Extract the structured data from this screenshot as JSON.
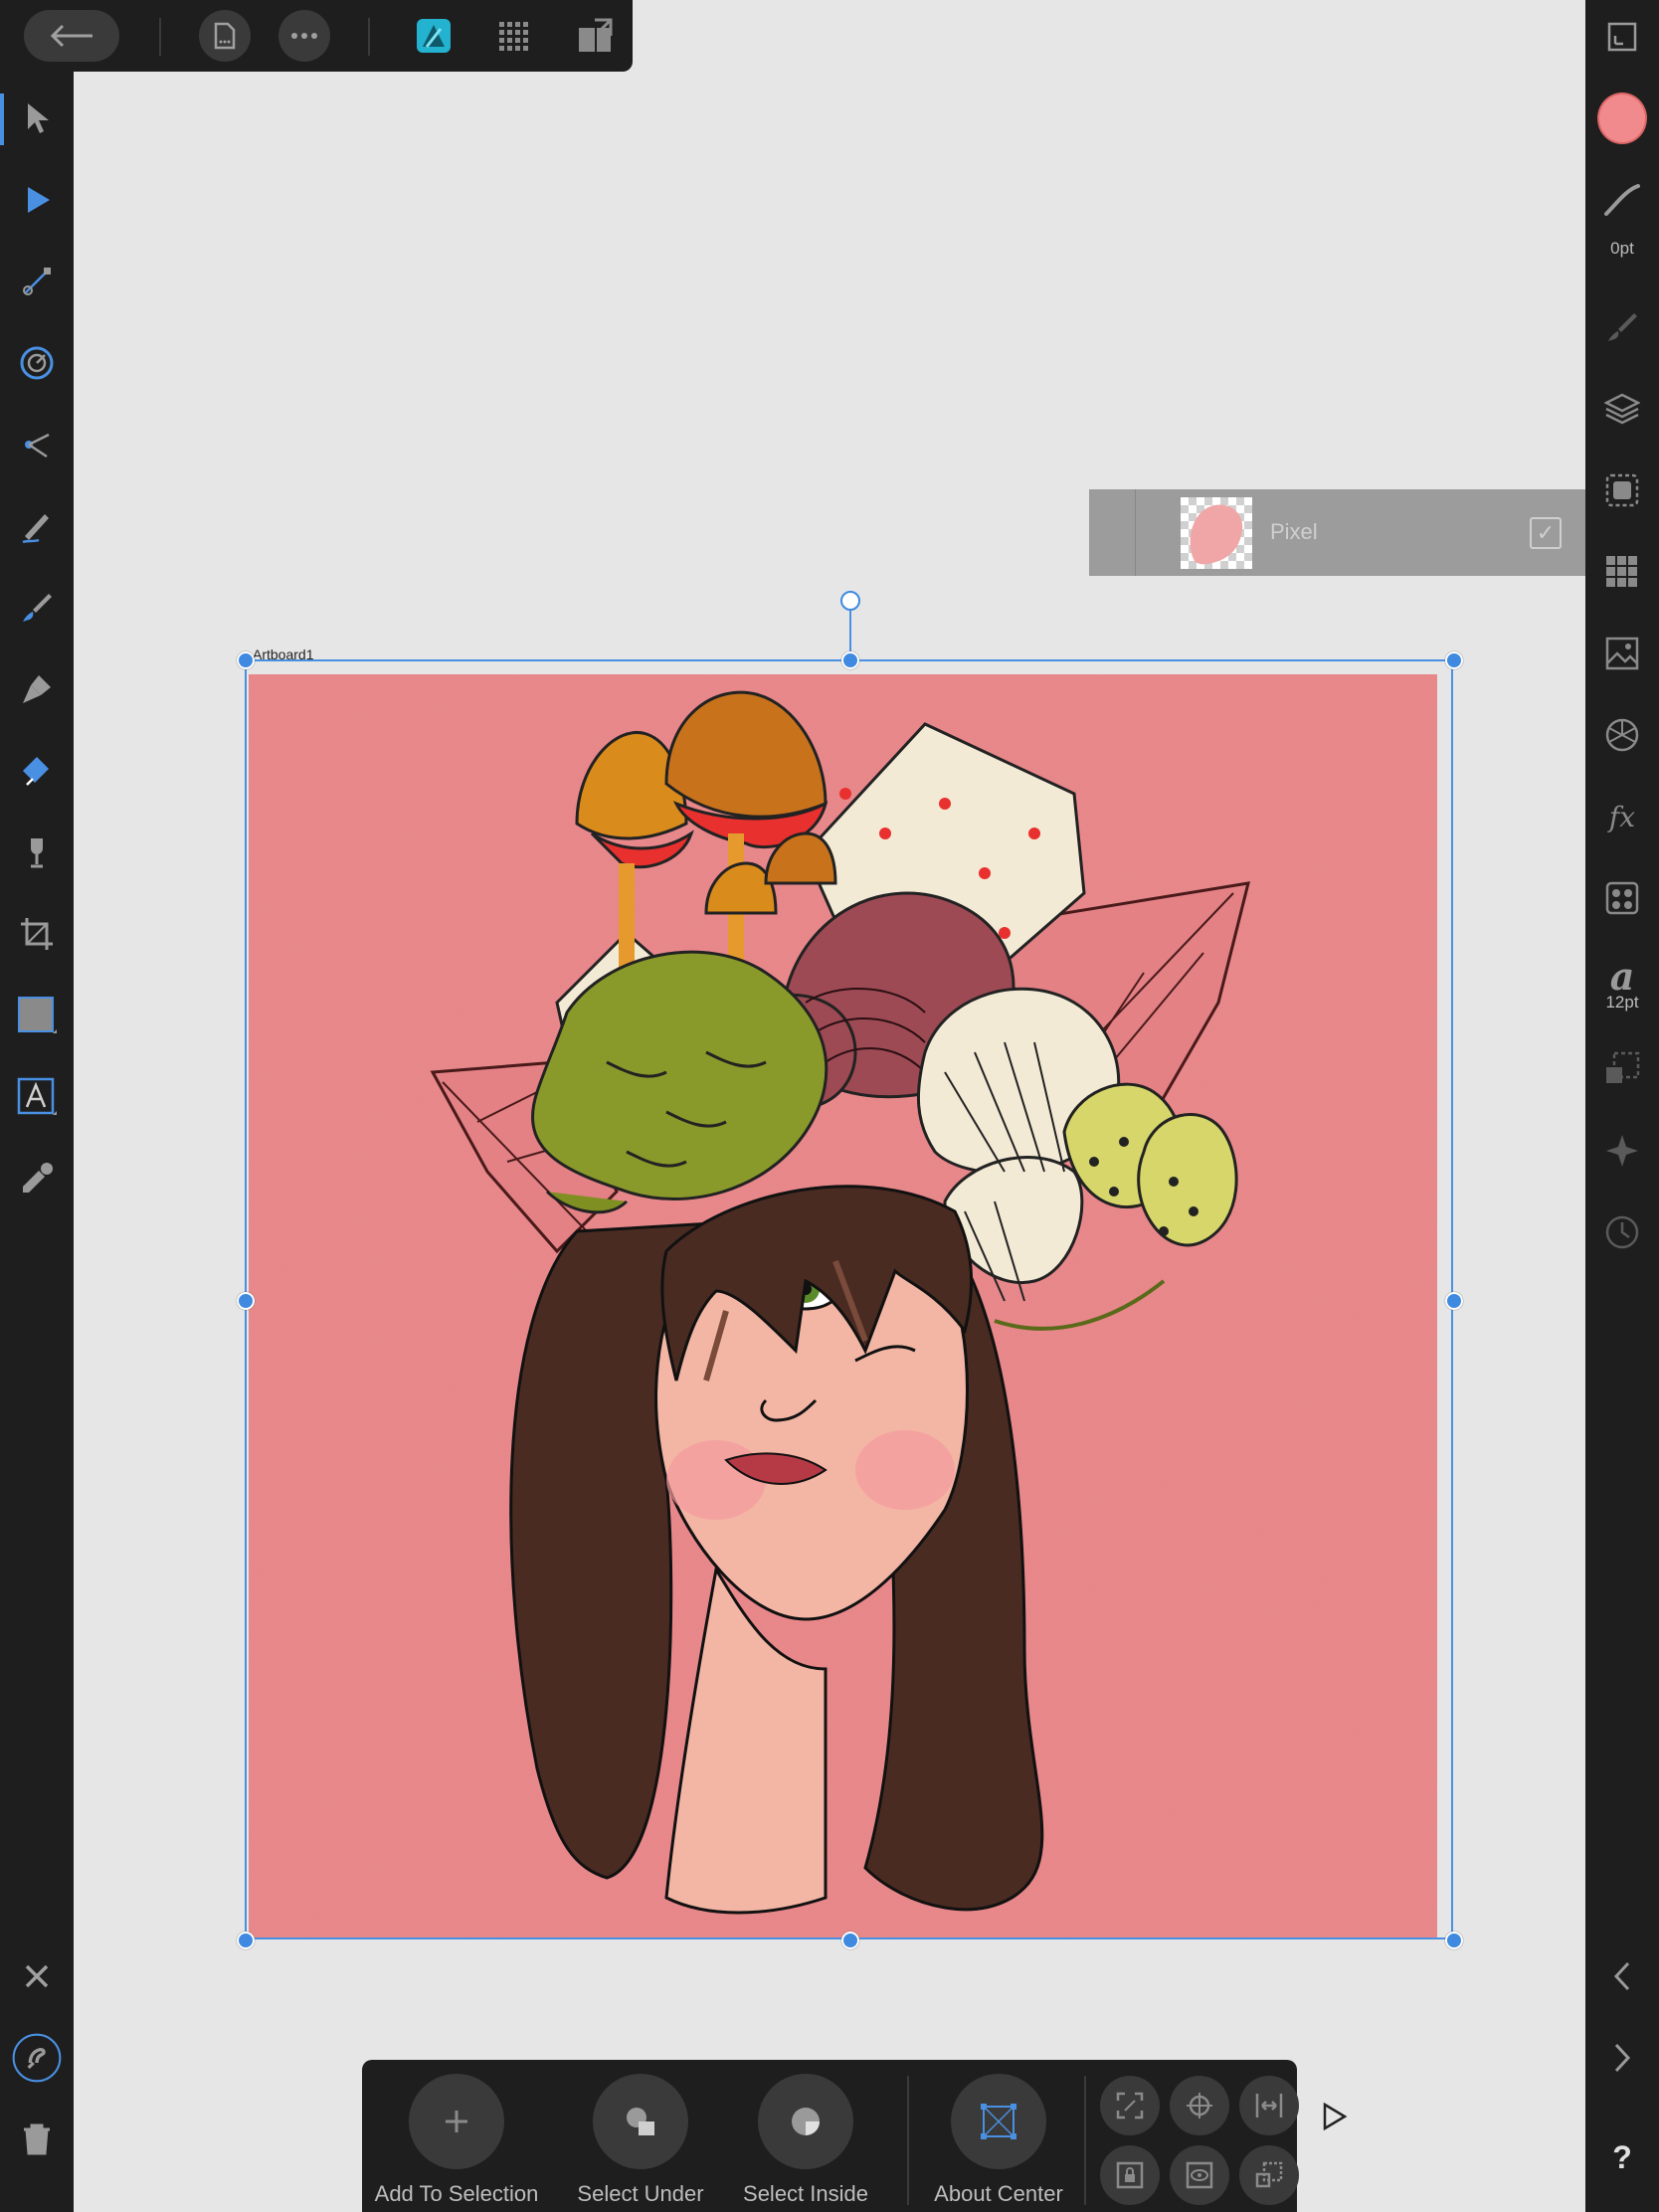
{
  "topbar": {
    "back_label": "Back",
    "document_menu": "document-icon",
    "more_menu": "more-icon",
    "personas": [
      "designer-persona-icon",
      "pixel-persona-icon",
      "export-persona-icon"
    ]
  },
  "left_tools": [
    "move-tool",
    "node-tool",
    "corner-tool",
    "rotate-tool",
    "point-transform-tool",
    "pencil-tool",
    "vector-brush-tool",
    "pen-tool",
    "fill-tool",
    "transparency-tool",
    "crop-tool",
    "rectangle-tool",
    "artistic-text-tool",
    "color-picker-tool"
  ],
  "right_studio": {
    "stroke_width": "0pt",
    "text_size": "12pt"
  },
  "layer_popup": {
    "name": "Pixel",
    "checked": "✓"
  },
  "artboard": {
    "label": "Artboard1"
  },
  "context_toolbar": {
    "add_to_selection": "Add To Selection",
    "select_under": "Select Under",
    "select_inside": "Select Inside",
    "about_center": "About Center"
  },
  "colors": {
    "accent": "#4a90e2",
    "panel": "#1e1e1e",
    "canvas_bg": "#e6e6e6",
    "art_bg": "#ef8a8c"
  }
}
